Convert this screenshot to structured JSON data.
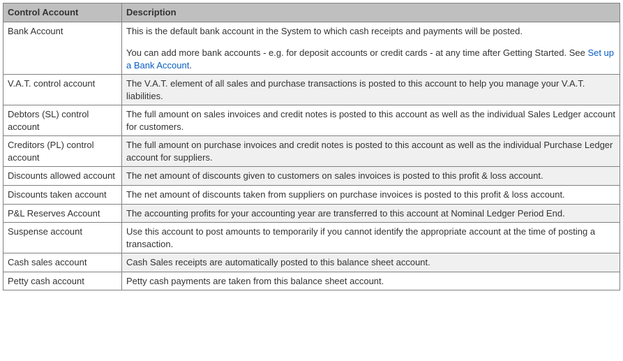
{
  "headers": {
    "account": "Control Account",
    "description": "Description"
  },
  "rows": [
    {
      "account": "Bank Account",
      "desc_pre": "This is the default bank account in the System to which cash receipts and payments will be posted.",
      "desc_mid": "You can add more bank accounts - e.g. for deposit accounts or credit cards - at any time after Getting Started.  See ",
      "link_text": "Set up a Bank Account",
      "desc_post": ".",
      "shaded": false,
      "has_link": true,
      "has_gap": true
    },
    {
      "account": "V.A.T. control account",
      "description": "The V.A.T. element of all sales and purchase transactions is posted to this account to help you manage your V.A.T. liabilities.",
      "shaded": true
    },
    {
      "account": "Debtors (SL) control account",
      "description": "The full amount on sales invoices and credit notes is posted to this account as well as the individual Sales Ledger account for customers.",
      "shaded": false
    },
    {
      "account": "Creditors (PL) control account",
      "description": "The full amount on purchase invoices and credit notes is posted to this account as well as the individual Purchase Ledger account for suppliers.",
      "shaded": true
    },
    {
      "account": "Discounts allowed account",
      "description": "The net amount of discounts given to customers on sales invoices is posted to this profit & loss account.",
      "shaded": true
    },
    {
      "account": "Discounts taken account",
      "description": "The net amount of discounts taken from suppliers on purchase invoices is posted to this profit & loss account.",
      "shaded": false
    },
    {
      "account": "P&L Reserves Account",
      "description": "The accounting profits for your accounting year are transferred to this account at Nominal Ledger Period End.",
      "shaded": true
    },
    {
      "account": "Suspense account",
      "description": "Use this account to post amounts to temporarily if you cannot identify the appropriate account at the time of posting a transaction.",
      "shaded": false
    },
    {
      "account": "Cash sales account",
      "description": "Cash Sales receipts are automatically posted to this balance sheet account.",
      "shaded": true
    },
    {
      "account": "Petty cash account",
      "description": "Petty cash payments are taken from this balance sheet account.",
      "shaded": false
    }
  ]
}
